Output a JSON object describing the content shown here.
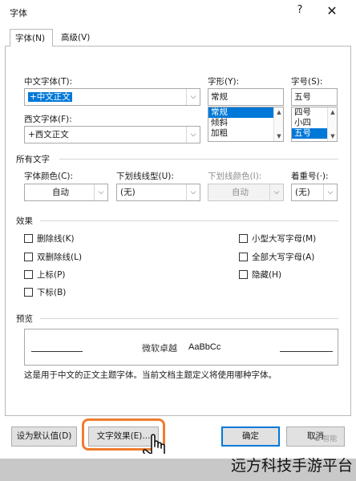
{
  "window": {
    "title": "字体",
    "help_label": "?",
    "close_label": "✕"
  },
  "tabs": [
    {
      "label": "字体(N)",
      "active": true
    },
    {
      "label": "高级(V)",
      "active": false
    }
  ],
  "font": {
    "chinese_label": "中文字体(T):",
    "chinese_value": "+中文正文",
    "western_label": "西文字体(F):",
    "western_value": "+西文正文",
    "style_label": "字形(Y):",
    "style_value": "常规",
    "style_options": [
      "常规",
      "倾斜",
      "加粗"
    ],
    "size_label": "字号(S):",
    "size_value": "五号",
    "size_options": [
      "四号",
      "小四",
      "五号"
    ]
  },
  "all_text": {
    "section_title": "所有文字",
    "font_color_label": "字体颜色(C):",
    "font_color_value": "自动",
    "underline_style_label": "下划线线型(U):",
    "underline_style_value": "(无)",
    "underline_color_label": "下划线颜色(I):",
    "underline_color_value": "自动",
    "emphasis_label": "着重号(·):",
    "emphasis_value": "(无)"
  },
  "effects": {
    "section_title": "效果",
    "left": [
      {
        "label": "删除线(K)",
        "checked": false
      },
      {
        "label": "双删除线(L)",
        "checked": false
      },
      {
        "label": "上标(P)",
        "checked": false
      },
      {
        "label": "下标(B)",
        "checked": false
      }
    ],
    "right": [
      {
        "label": "小型大写字母(M)",
        "checked": false
      },
      {
        "label": "全部大写字母(A)",
        "checked": false
      },
      {
        "label": "隐藏(H)",
        "checked": false
      }
    ]
  },
  "preview": {
    "section_title": "预览",
    "sample_cn": "微软卓越",
    "sample_latin": "AaBbCc",
    "note": "这是用于中文的正文主题字体。当前文档主题定义将使用哪种字体。"
  },
  "buttons": {
    "set_default": "设为默认值(D)",
    "text_effects": "文字效果(E)...",
    "ok": "确定",
    "cancel": "取消"
  },
  "watermark": {
    "text": "远方科技手游平台",
    "logo": "✿ 智能"
  },
  "colors": {
    "accent": "#0078d7",
    "highlight": "#f07c2e"
  }
}
